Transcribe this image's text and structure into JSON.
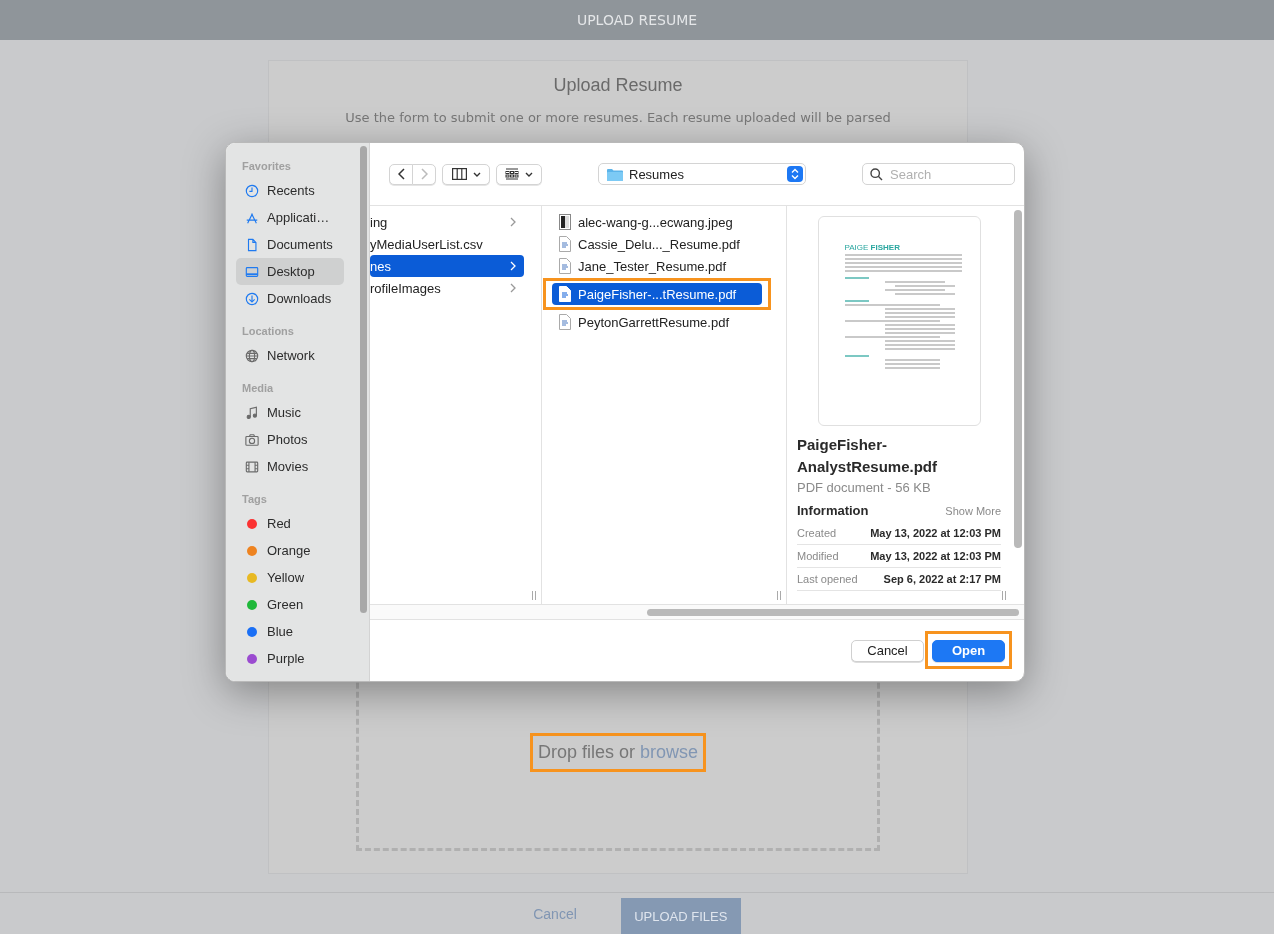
{
  "header": {
    "title": "UPLOAD RESUME"
  },
  "card": {
    "title": "Upload Resume",
    "description_lines": [
      "Use the form to submit one or more resumes. Each resume uploaded will be parsed"
    ],
    "dropzone": {
      "text": "Drop files or",
      "link": "browse",
      "highlighted": true
    }
  },
  "footer": {
    "cancel": "Cancel",
    "upload": "UPLOAD FILES"
  },
  "dialog": {
    "sidebar": [
      {
        "heading": "Favorites",
        "items": [
          {
            "label": "Recents",
            "kind": "clock",
            "selected": false
          },
          {
            "label": "Applicati…",
            "kind": "apps",
            "selected": false
          },
          {
            "label": "Documents",
            "kind": "document",
            "selected": false
          },
          {
            "label": "Desktop",
            "kind": "desktop",
            "selected": true
          },
          {
            "label": "Downloads",
            "kind": "download",
            "selected": false
          }
        ]
      },
      {
        "heading": "Locations",
        "items": [
          {
            "label": "Network",
            "kind": "globe",
            "selected": false
          }
        ]
      },
      {
        "heading": "Media",
        "items": [
          {
            "label": "Music",
            "kind": "music",
            "selected": false
          },
          {
            "label": "Photos",
            "kind": "camera",
            "selected": false
          },
          {
            "label": "Movies",
            "kind": "film",
            "selected": false
          }
        ]
      },
      {
        "heading": "Tags",
        "items": [
          {
            "label": "Red",
            "kind": "tag",
            "color": "#fb3232",
            "selected": false
          },
          {
            "label": "Orange",
            "kind": "tag",
            "color": "#ee8320",
            "selected": false
          },
          {
            "label": "Yellow",
            "kind": "tag",
            "color": "#e8b923",
            "selected": false
          },
          {
            "label": "Green",
            "kind": "tag",
            "color": "#1fb83a",
            "selected": false
          },
          {
            "label": "Blue",
            "kind": "tag",
            "color": "#1a6ff5",
            "selected": false
          },
          {
            "label": "Purple",
            "kind": "tag",
            "color": "#9b4bd0",
            "selected": false
          }
        ]
      }
    ],
    "toolbar": {
      "location": "Resumes",
      "search_placeholder": "Search"
    },
    "folders": [
      {
        "name": "ing",
        "kind": "folder",
        "selected": false
      },
      {
        "name": "yMediaUserList.csv",
        "kind": "file",
        "selected": false
      },
      {
        "name": "nes",
        "kind": "folder",
        "selected": true
      },
      {
        "name": "rofileImages",
        "kind": "folder",
        "selected": false
      }
    ],
    "files": [
      {
        "name": "alec-wang-g...ecwang.jpeg",
        "kind": "image",
        "selected": false,
        "highlighted": false
      },
      {
        "name": "Cassie_Delu..._Resume.pdf",
        "kind": "pdf",
        "selected": false,
        "highlighted": false
      },
      {
        "name": "Jane_Tester_Resume.pdf",
        "kind": "pdf",
        "selected": false,
        "highlighted": false
      },
      {
        "name": "PaigeFisher-...tResume.pdf",
        "kind": "pdf",
        "selected": true,
        "highlighted": true
      },
      {
        "name": "PeytonGarrettResume.pdf",
        "kind": "pdf",
        "selected": false,
        "highlighted": false
      }
    ],
    "preview": {
      "thumbnail_heading": "PAIGE **FISHER**",
      "name_lines": [
        "PaigeFisher-",
        "AnalystResume.pdf"
      ],
      "subtitle": "PDF document - 56 KB",
      "info_heading": "Information",
      "show_more": "Show More",
      "rows": [
        {
          "label": "Created",
          "value": "May 13, 2022 at 12:03 PM"
        },
        {
          "label": "Modified",
          "value": "May 13, 2022 at 12:03 PM"
        },
        {
          "label": "Last opened",
          "value": "Sep 6, 2022 at 2:17 PM"
        }
      ]
    },
    "buttons": [
      {
        "label": "Cancel",
        "kind": "default",
        "highlighted": false
      },
      {
        "label": "Open",
        "kind": "primary",
        "highlighted": true
      }
    ]
  }
}
